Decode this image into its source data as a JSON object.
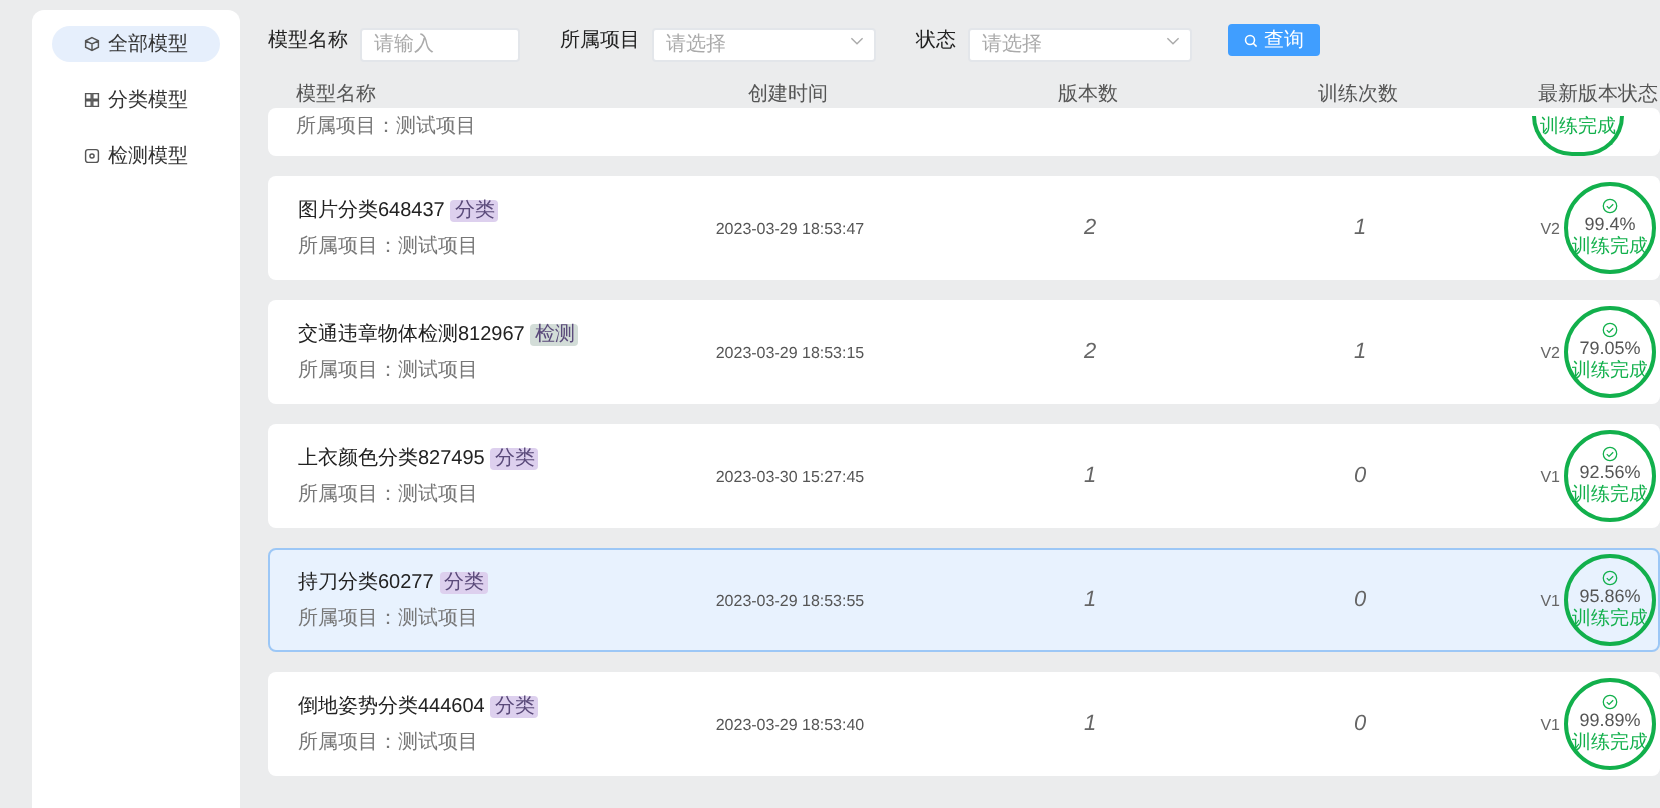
{
  "sidebar": {
    "items": [
      {
        "label": "全部模型",
        "selected": true
      },
      {
        "label": "分类模型",
        "selected": false
      },
      {
        "label": "检测模型",
        "selected": false
      }
    ]
  },
  "filters": {
    "fields": [
      {
        "label": "模型名称",
        "placeholder": "请输入",
        "kind": "input"
      },
      {
        "label": "所属项目",
        "placeholder": "请选择",
        "kind": "select"
      },
      {
        "label": "状态",
        "placeholder": "请选择",
        "kind": "select"
      }
    ],
    "search_button": "查询"
  },
  "table": {
    "columns": [
      "模型名称",
      "创建时间",
      "版本数",
      "训练次数",
      "最新版本状态"
    ],
    "partial_row": {
      "project": "所属项目：测试项目",
      "status": "训练完成"
    },
    "rows": [
      {
        "name": "图片分类648437",
        "tag": "分类",
        "color": "#ddd0ee",
        "project": "所属项目：测试项目",
        "created": "2023-03-29 18:53:47",
        "versions": "2",
        "trainings": "1",
        "version": "V2",
        "accuracy": "99.4%",
        "status": "训练完成",
        "selected": false
      },
      {
        "name": "交通违章物体检测812967",
        "tag": "检测",
        "color": "#d3ddd8",
        "project": "所属项目：测试项目",
        "created": "2023-03-29 18:53:15",
        "versions": "2",
        "trainings": "1",
        "version": "V2",
        "accuracy": "79.05%",
        "status": "训练完成",
        "selected": false
      },
      {
        "name": "上衣颜色分类827495",
        "tag": "分类",
        "color": "#ddd0ee",
        "project": "所属项目：测试项目",
        "created": "2023-03-30 15:27:45",
        "versions": "1",
        "trainings": "0",
        "version": "V1",
        "accuracy": "92.56%",
        "status": "训练完成",
        "selected": false
      },
      {
        "name": "持刀分类60277",
        "tag": "分类",
        "color": "#ddd0ee",
        "project": "所属项目：测试项目",
        "created": "2023-03-29 18:53:55",
        "versions": "1",
        "trainings": "0",
        "version": "V1",
        "accuracy": "95.86%",
        "status": "训练完成",
        "selected": true
      },
      {
        "name": "倒地姿势分类444604",
        "tag": "分类",
        "color": "#ddd0ee",
        "project": "所属项目：测试项目",
        "created": "2023-03-29 18:53:40",
        "versions": "1",
        "trainings": "0",
        "version": "V1",
        "accuracy": "99.89%",
        "status": "训练完成",
        "selected": false
      }
    ]
  }
}
